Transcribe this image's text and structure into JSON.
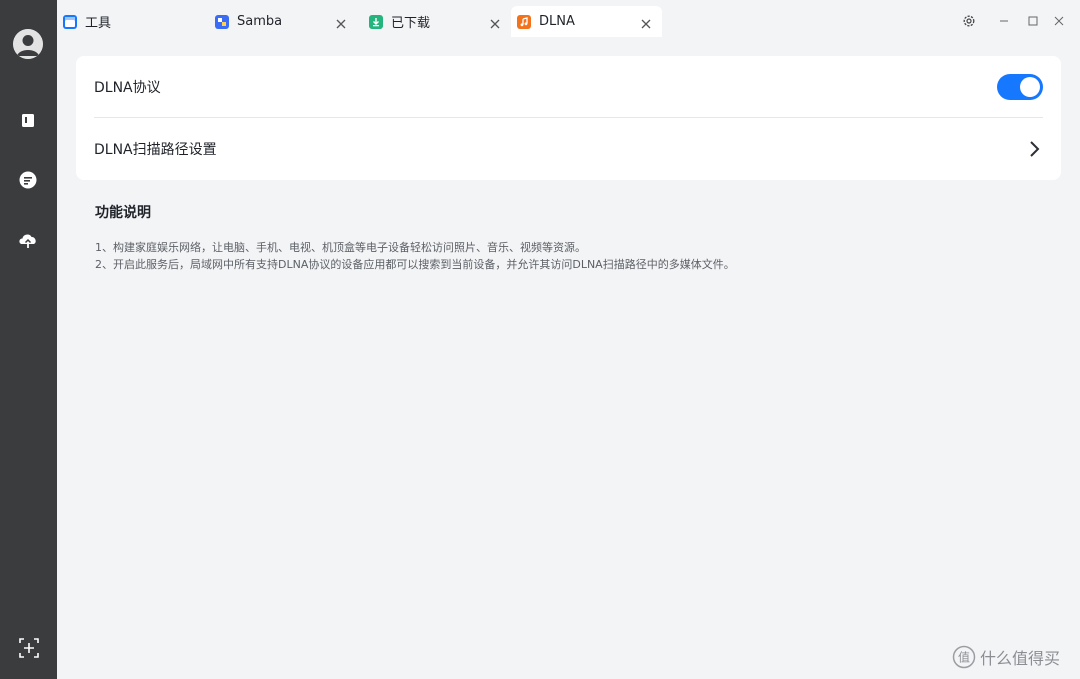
{
  "tabs": [
    {
      "label": "工具",
      "icon": "toolbox-icon",
      "color": "#1677ff",
      "closable": false,
      "active": false
    },
    {
      "label": "Samba",
      "icon": "samba-icon",
      "color": "#3b6cf6",
      "closable": true,
      "active": false
    },
    {
      "label": "已下载",
      "icon": "download-icon",
      "color": "#24b47e",
      "closable": true,
      "active": false
    },
    {
      "label": "DLNA",
      "icon": "dlna-icon",
      "color": "#f2731c",
      "closable": true,
      "active": true
    }
  ],
  "settings": {
    "dlna_protocol_label": "DLNA协议",
    "dlna_protocol_enabled": true,
    "scan_path_label": "DLNA扫描路径设置"
  },
  "description": {
    "title": "功能说明",
    "lines": [
      "1、构建家庭娱乐网络，让电脑、手机、电视、机顶盒等电子设备轻松访问照片、音乐、视频等资源。",
      "2、开启此服务后，局域网中所有支持DLNA协议的设备应用都可以搜索到当前设备，并允许其访问DLNA扫描路径中的多媒体文件。"
    ]
  },
  "watermark": {
    "text": "什么值得买",
    "logo": "值"
  },
  "colors": {
    "accent": "#1677ff",
    "sidebar": "#3b3c3e",
    "background": "#f3f4f6"
  }
}
